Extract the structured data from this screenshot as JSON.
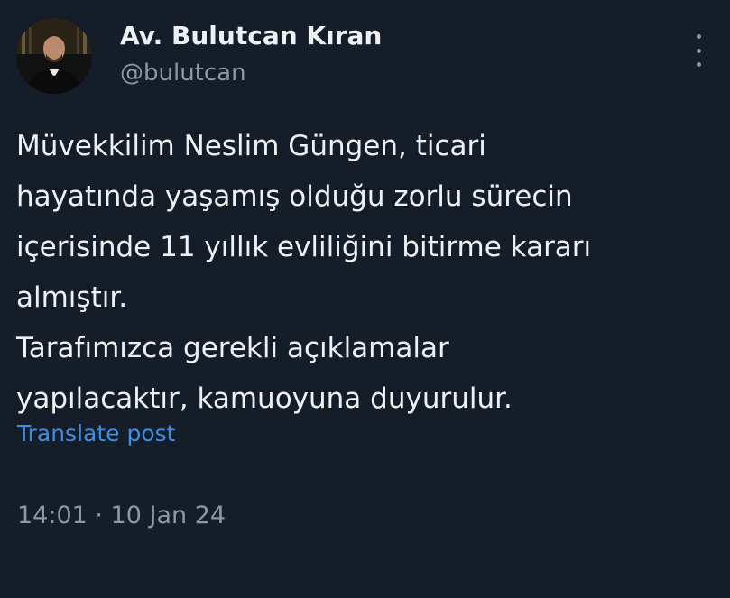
{
  "author": {
    "display_name": "Av. Bulutcan Kıran",
    "handle": "@bulutcan",
    "avatar_icon": "profile-photo"
  },
  "post": {
    "lines": [
      "Müvekkilim Neslim Güngen, ticari",
      "hayatında yaşamış olduğu zorlu sürecin",
      "içerisinde 11 yıllık evliliğini bitirme kararı",
      "almıştır.",
      "Tarafımızca gerekli açıklamalar",
      "yapılacaktır, kamuoyuna duyurulur."
    ],
    "translate_label": "Translate post",
    "timestamp": "14:01 · 10 Jan 24"
  },
  "menu": {
    "icon": "more-vertical-icon"
  },
  "colors": {
    "background": "#151d28",
    "text": "#eef1f3",
    "secondary": "#8b98a5",
    "link": "#3b8ee6"
  }
}
